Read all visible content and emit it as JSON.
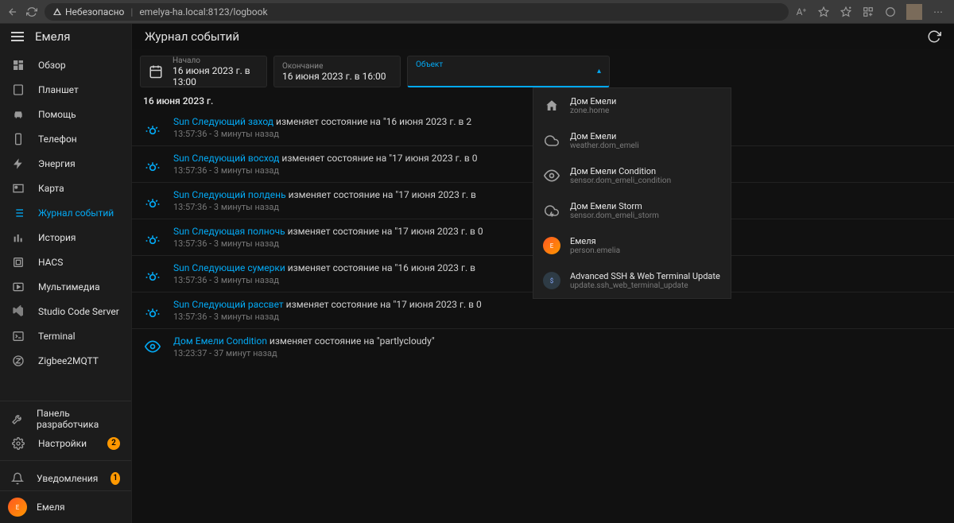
{
  "browser": {
    "warn_label": "Небезопасно",
    "url_host": "emelya-ha.local",
    "url_path": ":8123/logbook"
  },
  "app_name": "Емеля",
  "nav": [
    {
      "key": "overview",
      "label": "Обзор",
      "icon": "dashboard"
    },
    {
      "key": "tablet",
      "label": "Планшет",
      "icon": "tablet"
    },
    {
      "key": "help",
      "label": "Помощь",
      "icon": "car"
    },
    {
      "key": "phone",
      "label": "Телефон",
      "icon": "phone"
    },
    {
      "key": "energy",
      "label": "Энергия",
      "icon": "bolt"
    },
    {
      "key": "map",
      "label": "Карта",
      "icon": "map"
    },
    {
      "key": "logbook",
      "label": "Журнал событий",
      "icon": "list",
      "active": true
    },
    {
      "key": "history",
      "label": "История",
      "icon": "chart"
    },
    {
      "key": "hacs",
      "label": "HACS",
      "icon": "hacs"
    },
    {
      "key": "media",
      "label": "Мультимедиа",
      "icon": "play"
    },
    {
      "key": "vscode",
      "label": "Studio Code Server",
      "icon": "vscode"
    },
    {
      "key": "terminal",
      "label": "Terminal",
      "icon": "terminal"
    },
    {
      "key": "z2m",
      "label": "Zigbee2MQTT",
      "icon": "zigbee"
    }
  ],
  "nav_bottom": [
    {
      "key": "devtools",
      "label": "Панель разработчика",
      "icon": "wrench"
    },
    {
      "key": "settings",
      "label": "Настройки",
      "icon": "gear",
      "badge": "2"
    },
    {
      "key": "notifications",
      "label": "Уведомления",
      "icon": "bell",
      "badge": "1"
    }
  ],
  "user": {
    "name": "Емеля"
  },
  "page": {
    "title": "Журнал событий"
  },
  "filters": {
    "start_label": "Начало",
    "start_value": "16 июня 2023 г. в 13:00",
    "end_label": "Окончание",
    "end_value": "16 июня 2023 г. в 16:00",
    "entity_label": "Объект",
    "entity_value": ""
  },
  "date_header": "16 июня 2023 г.",
  "logs": [
    {
      "icon": "sun",
      "entity": "Sun Следующий заход",
      "text": " изменяет состояние на \"16 июня 2023 г. в 2",
      "ts": "13:57:36 - 3 минуты назад"
    },
    {
      "icon": "sun",
      "entity": "Sun Следующий восход",
      "text": " изменяет состояние на \"17 июня 2023 г. в 0",
      "ts": "13:57:36 - 3 минуты назад"
    },
    {
      "icon": "sun",
      "entity": "Sun Следующий полдень",
      "text": " изменяет состояние на \"17 июня 2023 г. в",
      "ts": "13:57:36 - 3 минуты назад"
    },
    {
      "icon": "sun",
      "entity": "Sun Следующая полночь",
      "text": " изменяет состояние на \"17 июня 2023 г. в 0",
      "ts": "13:57:36 - 3 минуты назад"
    },
    {
      "icon": "sun",
      "entity": "Sun Следующие сумерки",
      "text": " изменяет состояние на \"16 июня 2023 г. в",
      "ts": "13:57:36 - 3 минуты назад"
    },
    {
      "icon": "sun",
      "entity": "Sun Следующий рассвет",
      "text": " изменяет состояние на \"17 июня 2023 г. в 0",
      "ts": "13:57:36 - 3 минуты назад"
    },
    {
      "icon": "eye",
      "entity": "Дом Емели Condition",
      "text": " изменяет состояние на \"partlycloudy\"",
      "ts": "13:23:37 - 37 минут назад"
    }
  ],
  "dropdown": [
    {
      "icon": "home",
      "name": "Дом Емели",
      "id": "zone.home"
    },
    {
      "icon": "cloud",
      "name": "Дом Емели",
      "id": "weather.dom_emeli"
    },
    {
      "icon": "eye",
      "name": "Дом Емели Condition",
      "id": "sensor.dom_emeli_condition"
    },
    {
      "icon": "storm",
      "name": "Дом Емели Storm",
      "id": "sensor.dom_emeli_storm"
    },
    {
      "icon": "person",
      "name": "Емеля",
      "id": "person.emelia"
    },
    {
      "icon": "update",
      "name": "Advanced SSH & Web Terminal Update",
      "id": "update.ssh_web_terminal_update"
    }
  ]
}
